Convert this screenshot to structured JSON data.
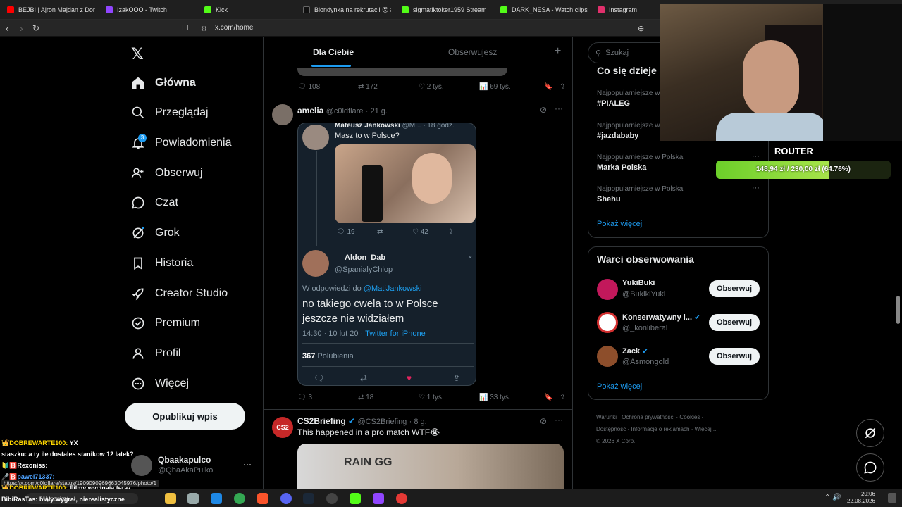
{
  "browser": {
    "tabs": [
      {
        "label": "BEJBI | Ajron Majdan z Donbas",
        "color": "#ff0000"
      },
      {
        "label": "IzakOOO - Twitch",
        "color": "#9146ff"
      },
      {
        "label": "Kick",
        "color": "#53fc18"
      },
      {
        "label": "Blondynka na rekrutacji 😮 #",
        "color": "#111111"
      },
      {
        "label": "sigmatiktoker1959 Stream",
        "color": "#53fc18"
      },
      {
        "label": "DARK_NESA - Watch clips on",
        "color": "#53fc18"
      },
      {
        "label": "Instagram",
        "color": "#e1306c"
      }
    ],
    "url": "x.com/home"
  },
  "sidebar": {
    "nav": [
      {
        "label": "Główna",
        "icon": "home-icon"
      },
      {
        "label": "Przeglądaj",
        "icon": "search-icon"
      },
      {
        "label": "Powiadomienia",
        "icon": "bell-icon",
        "badge": "3"
      },
      {
        "label": "Obserwuj",
        "icon": "add-user-icon"
      },
      {
        "label": "Czat",
        "icon": "chat-icon"
      },
      {
        "label": "Grok",
        "icon": "grok-icon"
      },
      {
        "label": "Historia",
        "icon": "bookmark-icon"
      },
      {
        "label": "Creator Studio",
        "icon": "rocket-icon"
      },
      {
        "label": "Premium",
        "icon": "verified-icon"
      },
      {
        "label": "Profil",
        "icon": "person-icon"
      },
      {
        "label": "Więcej",
        "icon": "more-circle-icon"
      }
    ],
    "post_button": "Opublikuj wpis",
    "account": {
      "name": "Qbaakapulco",
      "handle": "@QbaAkaPulko"
    }
  },
  "feed": {
    "tabs": [
      "Dla Ciebie",
      "Obserwujesz"
    ],
    "top_post_actions": {
      "replies": "108",
      "reposts": "172",
      "likes": "2 tys.",
      "views": "69 tys."
    },
    "post1": {
      "author": "amelia",
      "handle": "@c0ldflare",
      "time": "· 21 g.",
      "embed": {
        "quoted_author": "Mateusz Jankowski",
        "quoted_handle": "@M...",
        "quoted_time": "· 18 godz.",
        "quoted_text": "Masz to w Polsce?",
        "quoted_replies": "19",
        "quoted_likes": "42",
        "reply_name": "Aldon_Dab",
        "reply_handle": "@SpanialyChlop",
        "reply_to_prefix": "W odpowiedzi do",
        "reply_to_handle": "@MatiJankowski",
        "reply_text": "no takiego cwela to w Polsce jeszcze nie widziałem",
        "reply_time": "14:30 · 10 lut 20",
        "reply_source": "· Twitter for iPhone",
        "likes_count": "367",
        "likes_label": "Polubienia"
      },
      "actions": {
        "replies": "3",
        "reposts": "18",
        "likes": "1 tys.",
        "views": "33 tys."
      }
    },
    "post2": {
      "author": "CS2Briefing",
      "handle": "@CS2Briefing",
      "time": "· 8 g.",
      "avatar_text": "CS2",
      "text": "This happened in a pro match WTF😭",
      "media_text": "RAIN GG"
    }
  },
  "right": {
    "search_placeholder": "Szukaj",
    "trends_title": "Co się dzieje",
    "trends": [
      {
        "context": "Najpopularniejsze w",
        "name": "#PIALEG"
      },
      {
        "context": "Najpopularniejsze w",
        "name": "#jazdababy"
      },
      {
        "context": "Najpopularniejsze w Polska",
        "name": "Marka Polska"
      },
      {
        "context": "Najpopularniejsze w Polska",
        "name": "Shehu"
      }
    ],
    "show_more": "Pokaż więcej",
    "who_to_follow_title": "Warci obserwowania",
    "follow": [
      {
        "name": "YukiBuki",
        "handle": "@BukikiYuki",
        "verified": false,
        "button": "Obserwuj",
        "avatar_color": "#c2185b"
      },
      {
        "name": "Konserwatywny l...",
        "handle": "@_konliberal",
        "verified": true,
        "button": "Obserwuj",
        "avatar_color": "#d32f2f"
      },
      {
        "name": "Zack",
        "handle": "@Asmongold",
        "verified": true,
        "button": "Obserwuj",
        "avatar_color": "#8d4e2b"
      }
    ],
    "show_more2": "Pokaż więcej",
    "footer": [
      "Warunki",
      "Ochrona prywatności",
      "Cookies",
      "Dostępność",
      "Informacje o reklamach",
      "Więcej ...",
      "© 2026 X Corp."
    ]
  },
  "overlay": {
    "router_label": "ROUTER",
    "progress_text": "148,94 zł / 230,00 zł (64.76%)",
    "progress": 0.6476,
    "chat": [
      {
        "user": "👑DOBREWARTE100:",
        "msg": "YX",
        "color": "#ffd700"
      },
      {
        "user": "staszku:",
        "msg": "a ty ile dostales stanikow 12 latek?",
        "color": "#ffffff"
      },
      {
        "user": "🔰🅱️Rexoniss:",
        "msg": "",
        "color": "#ffffff"
      },
      {
        "user": "🎤🅱️pawel71337:",
        "msg": "",
        "color": "#4ea3ff"
      },
      {
        "user": "👑DOBREWARTE100:",
        "msg": "Filmy wycinają teraz",
        "color": "#ffd700"
      },
      {
        "user": "BibiRasTas:",
        "msg": "biały wygrał, nierealistyczne",
        "color": "#ffffff"
      }
    ],
    "status_url": "https://x.com/c0ldflare/status/1909090969663045976/photo/1"
  },
  "taskbar": {
    "search": "Wyszukaj",
    "time": "20:06",
    "date": "22.08.2026"
  }
}
